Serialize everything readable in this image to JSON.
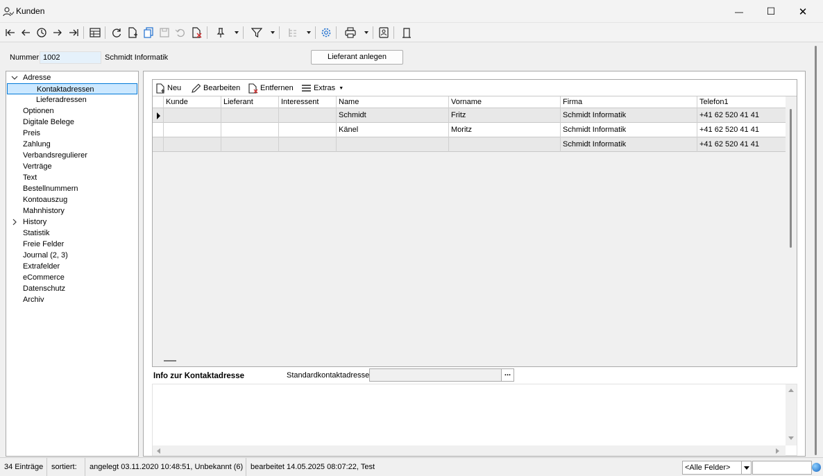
{
  "window": {
    "title": "Kunden",
    "minimize_glyph": "—",
    "maximize_glyph": "☐",
    "close_glyph": "✕"
  },
  "header": {
    "nummer_label": "Nummer",
    "nummer_value": "1002",
    "name": "Schmidt Informatik",
    "lieferant_button": "Lieferant anlegen"
  },
  "nav": {
    "items": [
      {
        "label": "Adresse"
      },
      {
        "label": "Kontaktadressen"
      },
      {
        "label": "Lieferadressen"
      },
      {
        "label": "Optionen"
      },
      {
        "label": "Digitale Belege"
      },
      {
        "label": "Preis"
      },
      {
        "label": "Zahlung"
      },
      {
        "label": "Verbandsregulierer"
      },
      {
        "label": "Verträge"
      },
      {
        "label": "Text"
      },
      {
        "label": "Bestellnummern"
      },
      {
        "label": "Kontoauszug"
      },
      {
        "label": "Mahnhistory"
      },
      {
        "label": "History"
      },
      {
        "label": "Statistik"
      },
      {
        "label": "Freie Felder"
      },
      {
        "label": "Journal (2, 3)"
      },
      {
        "label": "Extrafelder"
      },
      {
        "label": "eCommerce"
      },
      {
        "label": "Datenschutz"
      },
      {
        "label": "Archiv"
      }
    ]
  },
  "grid_toolbar": {
    "neu": "Neu",
    "bearbeiten": "Bearbeiten",
    "entfernen": "Entfernen",
    "extras": "Extras"
  },
  "grid": {
    "columns": [
      "Kunde",
      "Lieferant",
      "Interessent",
      "Name",
      "Vorname",
      "Firma",
      "Telefon1"
    ],
    "rows": [
      [
        "",
        "",
        "",
        "Schmidt",
        "Fritz",
        "Schmidt Informatik",
        "+41 62 520 41 41"
      ],
      [
        "",
        "",
        "",
        "Känel",
        "Moritz",
        "Schmidt Informatik",
        "+41 62 520 41 41"
      ],
      [
        "",
        "",
        "",
        "",
        "",
        "Schmidt Informatik",
        "+41 62 520 41 41"
      ]
    ]
  },
  "info": {
    "title": "Info zur Kontaktadresse",
    "std_label": "Standardkontaktadresse",
    "std_button": "..."
  },
  "status": {
    "count": "34 Einträge",
    "sorted": "sortiert:",
    "created": "angelegt 03.11.2020 10:48:51, Unbekannt (6)",
    "edited": "bearbeitet 14.05.2025 08:07:22, Test",
    "field_select": "<Alle Felder>"
  }
}
